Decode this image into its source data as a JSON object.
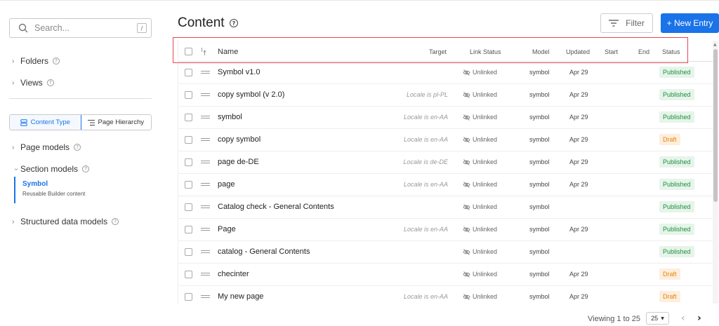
{
  "sidebar": {
    "search_placeholder": "Search...",
    "search_shortcut": "/",
    "folders_label": "Folders",
    "views_label": "Views",
    "tabs": [
      {
        "label": "Content Type",
        "active": true
      },
      {
        "label": "Page Hierarchy",
        "active": false
      }
    ],
    "page_models_label": "Page models",
    "section_models_label": "Section models",
    "selected_model": {
      "title": "Symbol",
      "description": "Reusable Builder content"
    },
    "structured_label": "Structured data models"
  },
  "header": {
    "title": "Content",
    "filter_label": "Filter",
    "new_entry_label": "+ New Entry"
  },
  "table": {
    "columns": {
      "name": "Name",
      "target": "Target",
      "link_status": "Link Status",
      "model": "Model",
      "updated": "Updated",
      "start": "Start",
      "end": "End",
      "status": "Status"
    },
    "rows": [
      {
        "name": "Symbol v1.0",
        "target": "",
        "link": "Unlinked",
        "model": "symbol",
        "updated": "Apr 29",
        "status": "Published"
      },
      {
        "name": "copy symbol (v 2.0)",
        "target": "Locale is pl-PL",
        "link": "Unlinked",
        "model": "symbol",
        "updated": "Apr 29",
        "status": "Published"
      },
      {
        "name": "symbol",
        "target": "Locale is en-AA",
        "link": "Unlinked",
        "model": "symbol",
        "updated": "Apr 29",
        "status": "Published"
      },
      {
        "name": "copy symbol",
        "target": "Locale is en-AA",
        "link": "Unlinked",
        "model": "symbol",
        "updated": "Apr 29",
        "status": "Draft"
      },
      {
        "name": "page de-DE",
        "target": "Locale is de-DE",
        "link": "Unlinked",
        "model": "symbol",
        "updated": "Apr 29",
        "status": "Published"
      },
      {
        "name": "page",
        "target": "Locale is en-AA",
        "link": "Unlinked",
        "model": "symbol",
        "updated": "Apr 29",
        "status": "Published"
      },
      {
        "name": "Catalog check - General Contents",
        "target": "",
        "link": "Unlinked",
        "model": "symbol",
        "updated": "",
        "status": "Published"
      },
      {
        "name": "Page",
        "target": "Locale is en-AA",
        "link": "Unlinked",
        "model": "symbol",
        "updated": "Apr 29",
        "status": "Published"
      },
      {
        "name": "catalog - General Contents",
        "target": "",
        "link": "Unlinked",
        "model": "symbol",
        "updated": "",
        "status": "Published"
      },
      {
        "name": "checinter",
        "target": "",
        "link": "Unlinked",
        "model": "symbol",
        "updated": "Apr 29",
        "status": "Draft"
      },
      {
        "name": "My new page",
        "target": "Locale is en-AA",
        "link": "Unlinked",
        "model": "symbol",
        "updated": "Apr 29",
        "status": "Draft"
      }
    ]
  },
  "pagination": {
    "viewing_text": "Viewing 1 to 25",
    "page_size": "25"
  },
  "colors": {
    "accent": "#1a73e8",
    "published_text": "#1e8e3e",
    "published_bg": "#e6f4ea",
    "draft_text": "#e8830c",
    "draft_bg": "#fdeedd",
    "highlight": "#e8464f"
  }
}
